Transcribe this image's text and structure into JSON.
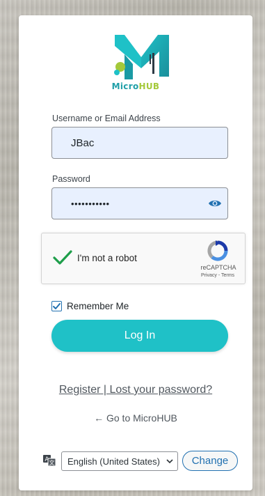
{
  "brand": {
    "part1": "Micro",
    "part2": "HUB"
  },
  "username": {
    "label": "Username or Email Address",
    "value": "JBac"
  },
  "password": {
    "label": "Password",
    "value": "•••••••••••"
  },
  "captcha": {
    "text": "I'm not a robot",
    "brand": "reCAPTCHA",
    "links": "Privacy - Terms"
  },
  "remember": {
    "label": "Remember Me",
    "checked": true
  },
  "login": {
    "label": "Log In"
  },
  "footer": {
    "register": "Register",
    "separator": " | ",
    "lost": "Lost your password?",
    "goto": "← Go to MicroHUB"
  },
  "language": {
    "selected": "English (United States)",
    "change_label": "Change"
  },
  "colors": {
    "accent": "#1fc1c7",
    "brand_teal": "#1f9fa8",
    "brand_green": "#a4c93a",
    "link": "#2271b1"
  },
  "icons": {
    "password_toggle": "eye-icon",
    "language": "translate-icon",
    "captcha_check": "checkmark-icon"
  }
}
